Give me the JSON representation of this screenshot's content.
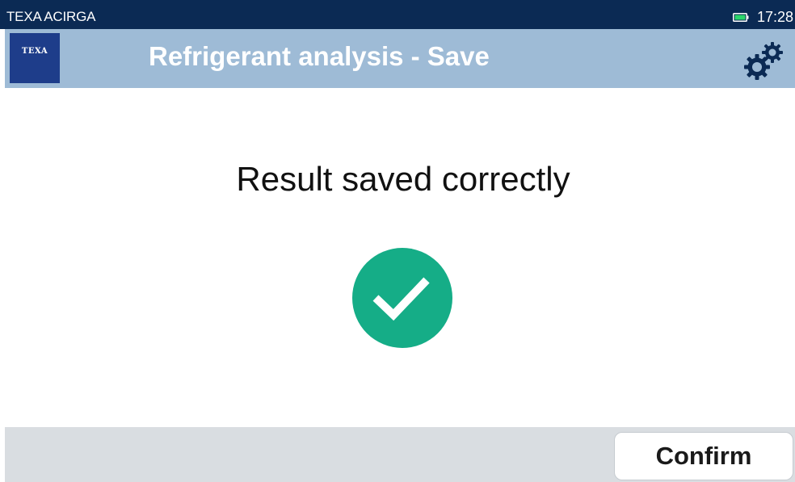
{
  "status_bar": {
    "app_name": "TEXA ACIRGA",
    "time": "17:28",
    "battery_icon": "battery-icon",
    "battery_color": "#2bd66b"
  },
  "header": {
    "logo_text": "TEXA",
    "title": "Refrigerant analysis - Save",
    "settings_icon": "gears-icon"
  },
  "main": {
    "message": "Result saved correctly",
    "status_icon": "check-circle-icon",
    "success_color": "#15ad87"
  },
  "footer": {
    "confirm_label": "Confirm"
  },
  "colors": {
    "status_bar_bg": "#0b2a54",
    "header_bg": "#9ebbd6",
    "header_icon": "#0b2a54",
    "logo_bg": "#1e3d8a",
    "footer_bg": "#d9dde1"
  }
}
